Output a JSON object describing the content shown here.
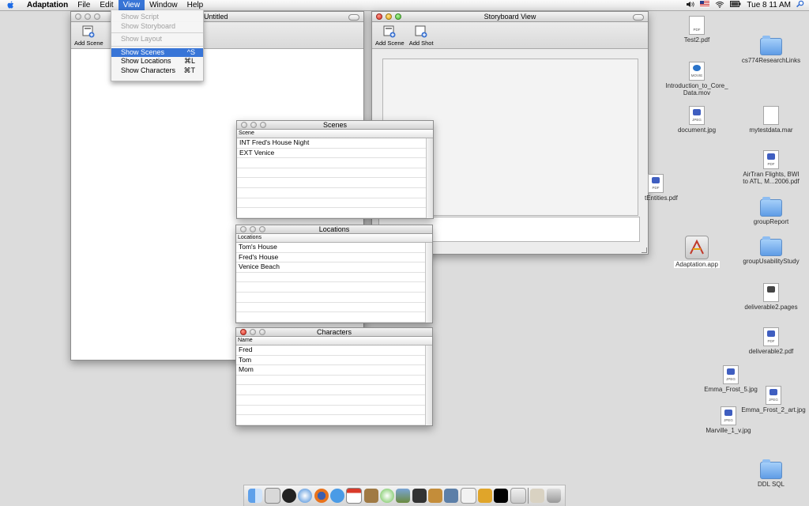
{
  "menubar": {
    "app_name": "Adaptation",
    "items": [
      "File",
      "Edit",
      "View",
      "Window",
      "Help"
    ],
    "clock": "Tue 8 11 AM"
  },
  "view_menu": {
    "items": [
      {
        "label": "Show Script",
        "shortcut": "",
        "disabled": true
      },
      {
        "label": "Show Storyboard",
        "shortcut": "",
        "disabled": true
      },
      {
        "label": "Show Layout",
        "shortcut": "",
        "disabled": true
      },
      {
        "label": "Show Scenes",
        "shortcut": "^S",
        "selected": true
      },
      {
        "label": "Show Locations",
        "shortcut": "⌘L"
      },
      {
        "label": "Show Characters",
        "shortcut": "⌘T"
      }
    ]
  },
  "script_window": {
    "title": "Untitled",
    "toolbar": {
      "add_scene": "Add Scene",
      "truncated": "A"
    }
  },
  "storyboard_window": {
    "title": "Storyboard View",
    "toolbar": {
      "add_scene": "Add Scene",
      "add_shot": "Add Shot"
    }
  },
  "scenes_panel": {
    "title": "Scenes",
    "column": "Scene",
    "rows": [
      "INT Fred's House Night",
      "EXT Venice"
    ]
  },
  "locations_panel": {
    "title": "Locations",
    "column": "Locations",
    "rows": [
      "Tom's House",
      "Fred's House",
      "Venice Beach"
    ]
  },
  "characters_panel": {
    "title": "Characters",
    "column": "Name",
    "rows": [
      "Fred",
      "Tom",
      "Mom"
    ]
  },
  "desktop_icons": {
    "test2pdf": {
      "label": "Test2.pdf",
      "tag": "PDF",
      "icon": "pdf-file-icon"
    },
    "cs774": {
      "label": "cs774ResearchLinks",
      "icon": "folder-icon"
    },
    "intro_movie": {
      "label": "Introduction_to_Core_\nData.mov",
      "tag": "MOVIE",
      "icon": "movie-file-icon"
    },
    "document_jpg": {
      "label": "document.jpg",
      "tag": "JPEG",
      "icon": "jpeg-file-icon"
    },
    "mytestdata": {
      "label": "mytestdata.mar",
      "icon": "document-icon"
    },
    "airtran": {
      "label": "AirTran Flights, BWI\nto ATL, M...2006.pdf",
      "tag": "PDF",
      "icon": "pdf-file-icon"
    },
    "entities": {
      "label": "tEntities.pdf",
      "tag": "PDF",
      "icon": "pdf-file-icon"
    },
    "groupreport": {
      "label": "groupReport",
      "icon": "folder-icon"
    },
    "adaptation_app": {
      "label": "Adaptation.app",
      "icon": "application-icon"
    },
    "usability": {
      "label": "groupUsabilityStudy",
      "icon": "folder-icon"
    },
    "deliverable2pages": {
      "label": "deliverable2.pages",
      "icon": "pages-file-icon"
    },
    "deliverable2pdf": {
      "label": "deliverable2.pdf",
      "tag": "PDF",
      "icon": "pdf-file-icon"
    },
    "emma1": {
      "label": "Emma_Frost_5.jpg",
      "tag": "JPEG",
      "icon": "jpeg-file-icon"
    },
    "emma2": {
      "label": "Emma_Frost_2_art.jpg",
      "tag": "JPEG",
      "icon": "jpeg-file-icon"
    },
    "marville": {
      "label": "Marville_1_v.jpg",
      "tag": "JPEG",
      "icon": "jpeg-file-icon"
    },
    "ddlsql": {
      "label": "DDL SQL",
      "icon": "folder-icon"
    }
  },
  "dock": {
    "icons": [
      "finder-icon",
      "mail-icon",
      "dashboard-icon",
      "safari-icon",
      "firefox-icon",
      "ichat-icon",
      "ical-icon",
      "address-book-icon",
      "itunes-icon",
      "iphoto-icon",
      "imovie-icon",
      "garageband-icon",
      "xcode-icon",
      "textedit-icon",
      "preview-icon",
      "terminal-icon",
      "adaptation-icon",
      "home-folder-icon",
      "trash-icon"
    ]
  },
  "colors": {
    "menu_highlight": "#3875d7",
    "desktop": "#dcdcdc"
  }
}
